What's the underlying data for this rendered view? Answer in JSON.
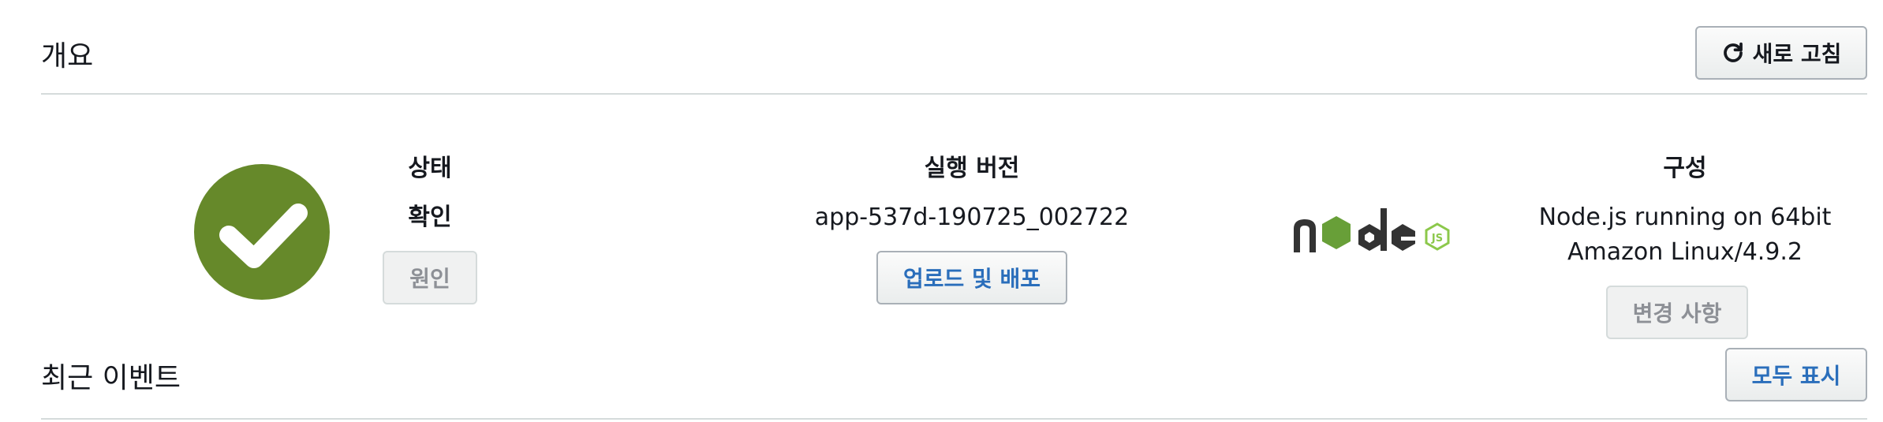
{
  "overview": {
    "title": "개요",
    "refresh_label": "새로 고침",
    "refresh_icon": "refresh-icon"
  },
  "health": {
    "icon": "check-circle-icon",
    "icon_color": "#66892a",
    "label": "상태",
    "value": "확인",
    "causes_label": "원인"
  },
  "version": {
    "label": "실행 버전",
    "value": "app-537d-190725_002722",
    "upload_label": "업로드 및 배포"
  },
  "config": {
    "platform_logo": "nodejs-logo",
    "logo_text": "node",
    "logo_badge": "JS",
    "label": "구성",
    "value": "Node.js running on 64bit Amazon Linux/4.9.2",
    "change_label": "변경 사항"
  },
  "events": {
    "title": "최근 이벤트",
    "show_all_label": "모두 표시"
  }
}
